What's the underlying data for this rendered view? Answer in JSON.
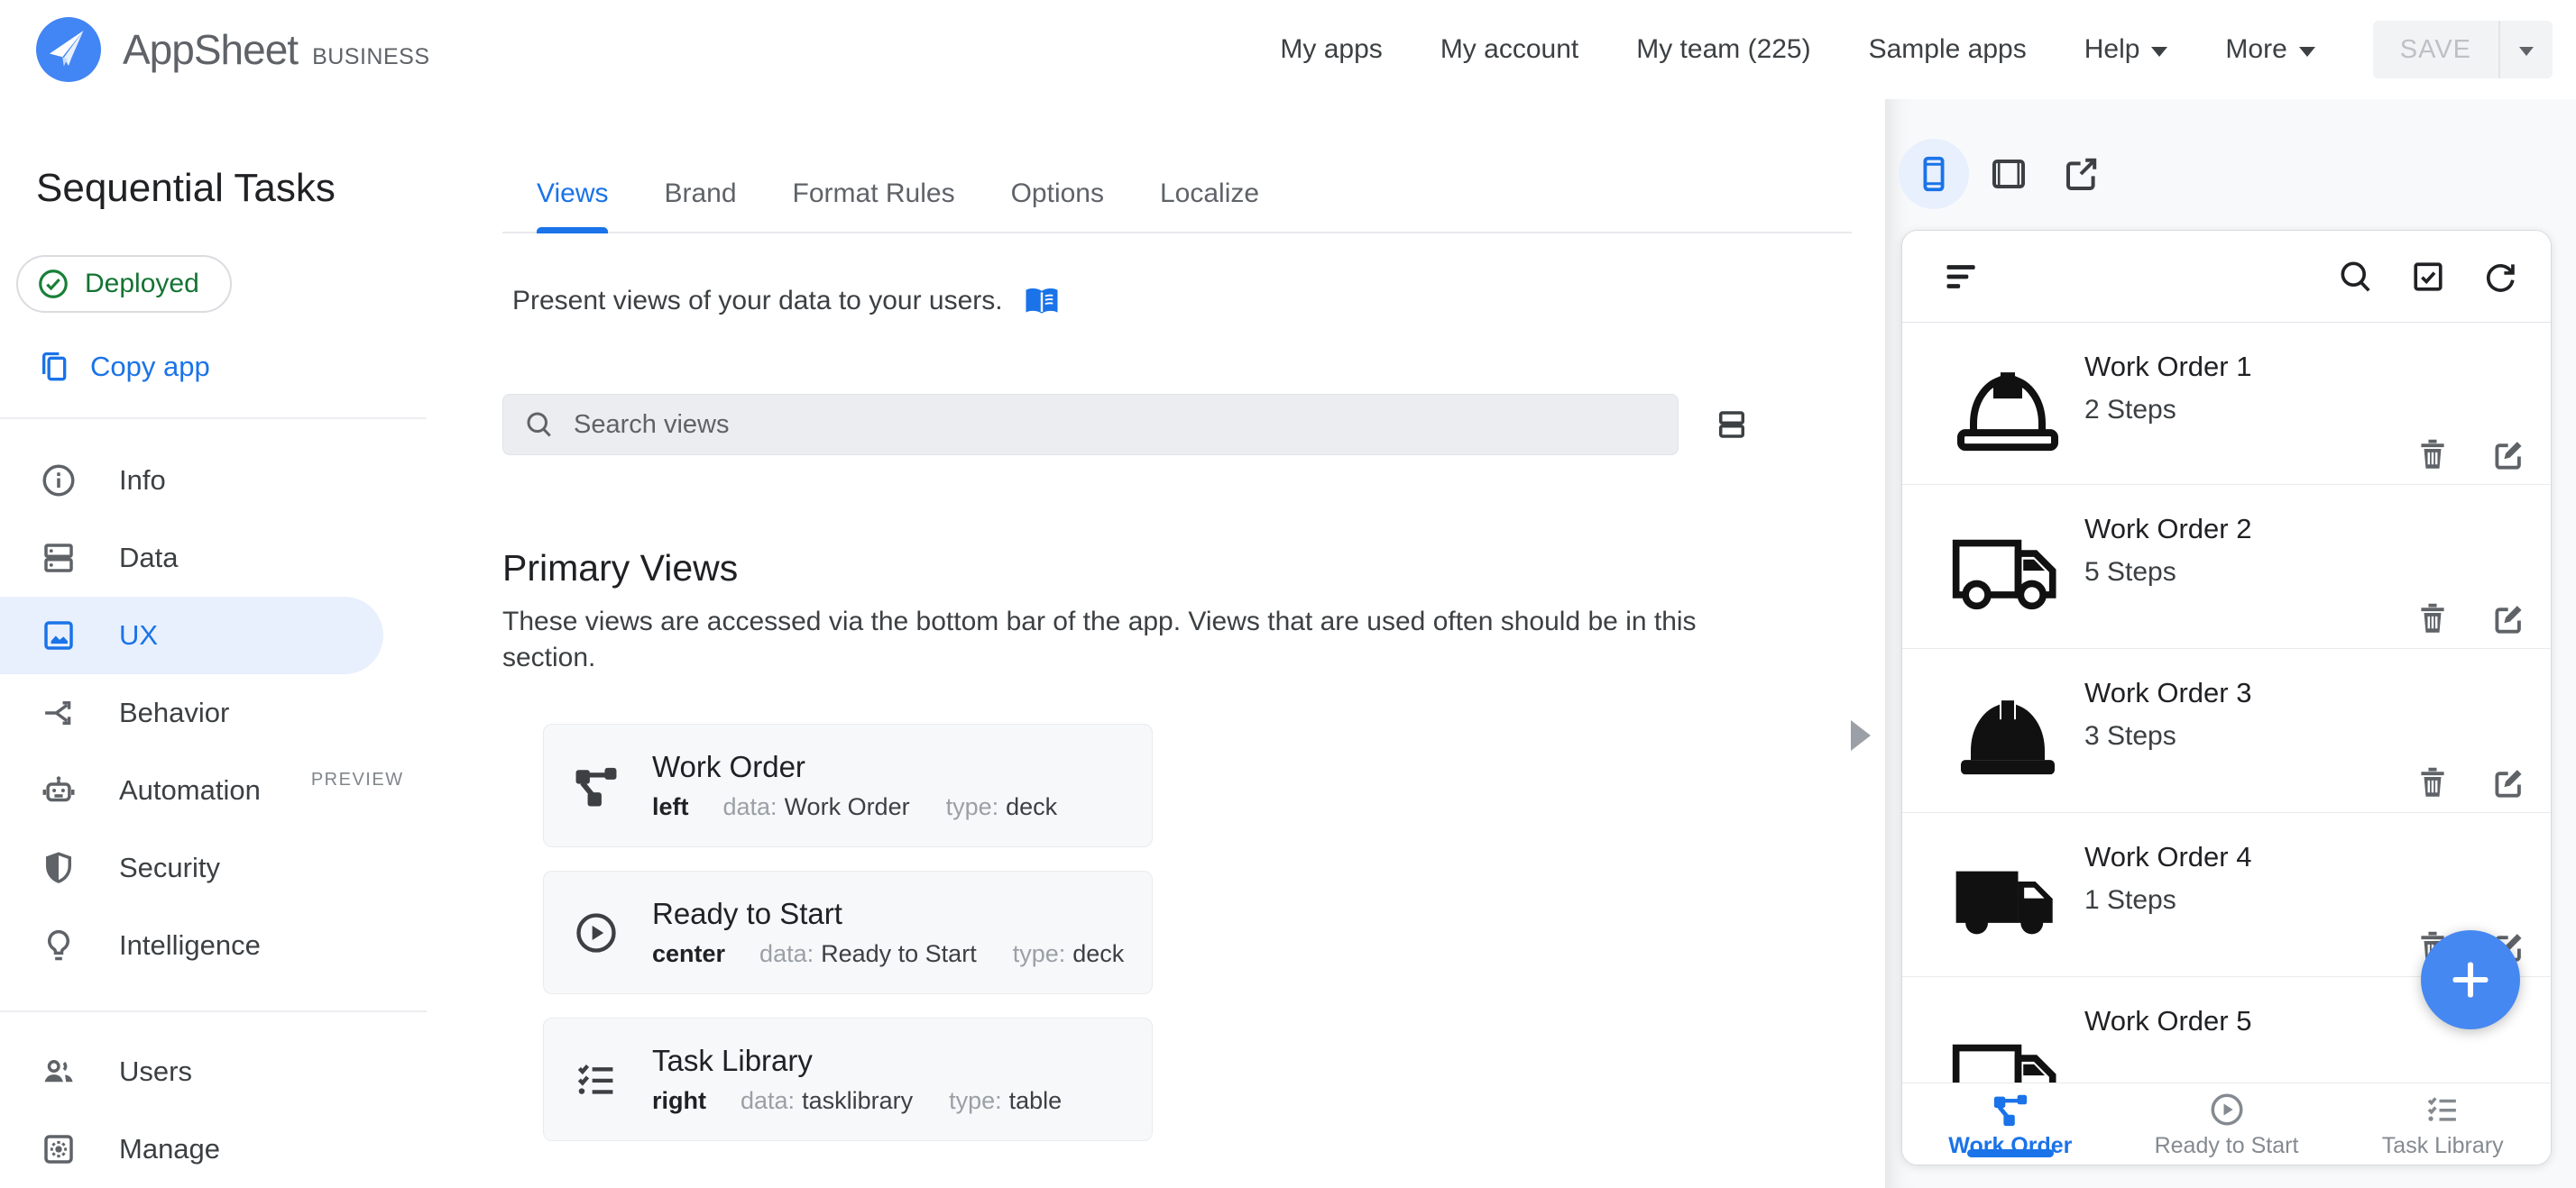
{
  "header": {
    "brand": {
      "name": "AppSheet",
      "tier": "BUSINESS"
    },
    "nav": [
      {
        "label": "My apps"
      },
      {
        "label": "My account"
      },
      {
        "label": "My team (225)"
      },
      {
        "label": "Sample apps"
      },
      {
        "label": "Help",
        "has_menu": true
      },
      {
        "label": "More",
        "has_menu": true
      }
    ],
    "save": {
      "label": "SAVE",
      "enabled": false
    }
  },
  "sidebar": {
    "app_title": "Sequential Tasks",
    "status_badge": "Deployed",
    "copy_app": "Copy app",
    "items": [
      {
        "label": "Info",
        "icon": "info-icon"
      },
      {
        "label": "Data",
        "icon": "database-icon"
      },
      {
        "label": "UX",
        "icon": "image-icon",
        "active": true
      },
      {
        "label": "Behavior",
        "icon": "split-arrow-icon"
      },
      {
        "label": "Automation",
        "icon": "robot-icon",
        "badge": "PREVIEW"
      },
      {
        "label": "Security",
        "icon": "shield-icon"
      },
      {
        "label": "Intelligence",
        "icon": "lightbulb-icon"
      },
      {
        "label": "Users",
        "icon": "people-icon"
      },
      {
        "label": "Manage",
        "icon": "gear-icon"
      }
    ]
  },
  "main": {
    "tabs": [
      {
        "label": "Views",
        "active": true
      },
      {
        "label": "Brand"
      },
      {
        "label": "Format Rules"
      },
      {
        "label": "Options"
      },
      {
        "label": "Localize"
      }
    ],
    "intro": "Present views of your data to your users.",
    "search_placeholder": "Search views",
    "section_title": "Primary Views",
    "section_description": "These views are accessed via the bottom bar of the app. Views that are used often should be in this section.",
    "views": [
      {
        "title": "Work Order",
        "icon": "deck-icon",
        "position": "left",
        "data_label": "data:",
        "data_value": "Work Order",
        "type_label": "type:",
        "type_value": "deck"
      },
      {
        "title": "Ready to Start",
        "icon": "play-circle-icon",
        "position": "center",
        "data_label": "data:",
        "data_value": "Ready to Start",
        "type_label": "type:",
        "type_value": "deck"
      },
      {
        "title": "Task Library",
        "icon": "checklist-icon",
        "position": "right",
        "data_label": "data:",
        "data_value": "tasklibrary",
        "type_label": "type:",
        "type_value": "table"
      }
    ]
  },
  "preview": {
    "device_toolbar": [
      {
        "name": "phone",
        "active": true
      },
      {
        "name": "tablet"
      },
      {
        "name": "open-external"
      }
    ],
    "rows": [
      {
        "title": "Work Order 1",
        "subtitle": "2 Steps",
        "icon": "hardhat-outline-icon"
      },
      {
        "title": "Work Order 2",
        "subtitle": "5 Steps",
        "icon": "truck-outline-icon"
      },
      {
        "title": "Work Order 3",
        "subtitle": "3 Steps",
        "icon": "hardhat-filled-icon"
      },
      {
        "title": "Work Order 4",
        "subtitle": "1 Steps",
        "icon": "truck-filled-icon"
      },
      {
        "title": "Work Order 5",
        "subtitle": "",
        "icon": "truck-outline-icon"
      }
    ],
    "bottom_nav": [
      {
        "label": "Work Order",
        "icon": "deck-icon",
        "active": true
      },
      {
        "label": "Ready to Start",
        "icon": "play-circle-icon"
      },
      {
        "label": "Task Library",
        "icon": "checklist-icon"
      }
    ]
  },
  "colors": {
    "accent_blue": "#1a73e8",
    "selected_bg": "#e8f0fe",
    "deployed_green": "#137333",
    "fab_blue": "#4688f1",
    "logo_blue": "#4285f4",
    "text_primary": "#202124",
    "text_secondary": "#5f6368"
  }
}
